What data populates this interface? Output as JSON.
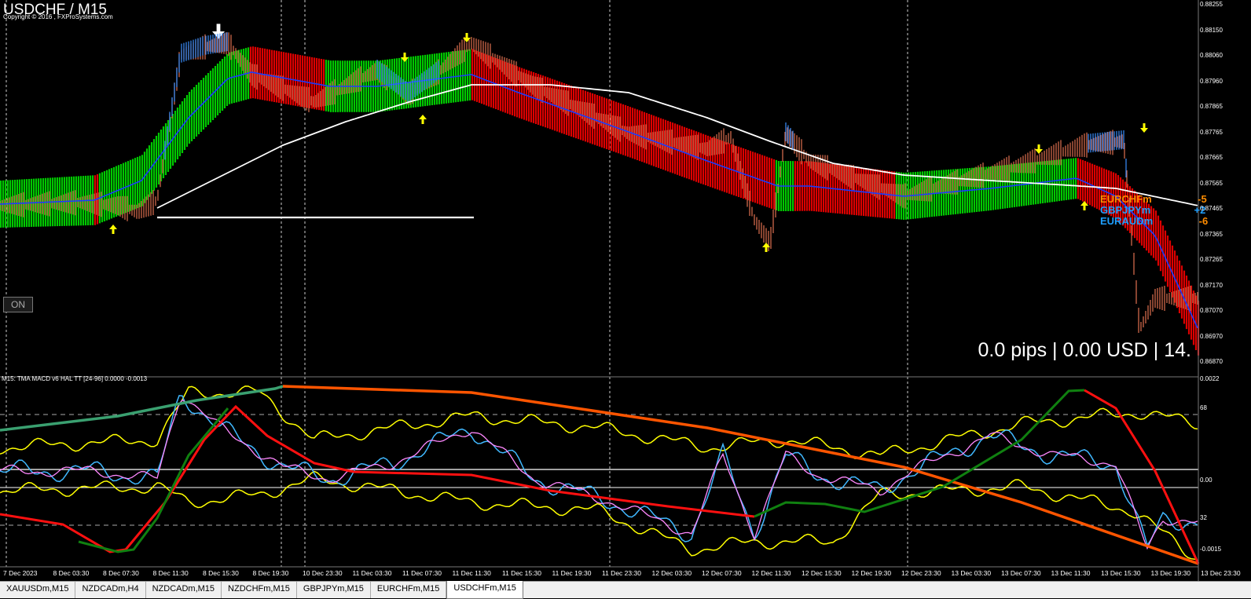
{
  "chart": {
    "title": "USDCHF / M15",
    "copyright": "Copyright © 2016 , FXProSystems.com",
    "on_button": "ON",
    "pips_readout": "0.0 pips | 0.00 USD | 14.",
    "indicator_label": "M15: TMA MACD v6 HAL TT [24-96] 0.0000 -0.0013",
    "symbols": [
      {
        "name": "EURCHFm",
        "value": "-5",
        "color": "#ff8c00"
      },
      {
        "name": "GBPJPYm",
        "value": "+2",
        "color": "#1e9fff"
      },
      {
        "name": "EURAUDm",
        "value": "-6",
        "color": "#1e9fff"
      }
    ],
    "price_axis": [
      "0.88255",
      "0.88150",
      "0.88060",
      "0.87960",
      "0.87865",
      "0.87765",
      "0.87665",
      "0.87565",
      "0.87465",
      "0.87365",
      "0.87265",
      "0.87170",
      "0.87070",
      "0.86970",
      "0.86870"
    ],
    "indicator_axis": [
      "0.0022",
      "68",
      "0.00",
      "32",
      "-0.0015"
    ],
    "time_axis": [
      "7 Dec 2023",
      "8 Dec 03:30",
      "8 Dec 07:30",
      "8 Dec 11:30",
      "8 Dec 15:30",
      "8 Dec 19:30",
      "10 Dec 23:30",
      "11 Dec 03:30",
      "11 Dec 07:30",
      "11 Dec 11:30",
      "11 Dec 15:30",
      "11 Dec 19:30",
      "11 Dec 23:30",
      "12 Dec 03:30",
      "12 Dec 07:30",
      "12 Dec 11:30",
      "12 Dec 15:30",
      "12 Dec 19:30",
      "12 Dec 23:30",
      "13 Dec 03:30",
      "13 Dec 07:30",
      "13 Dec 11:30",
      "13 Dec 15:30",
      "13 Dec 19:30",
      "13 Dec 23:30"
    ],
    "colors": {
      "bull": "#00c800",
      "bear": "#dd0000",
      "mid": "#1a3cff",
      "ma": "#ffffff",
      "arrow": "#ffff00"
    }
  },
  "tabs": [
    {
      "label": "XAUUSDm,M15",
      "active": false
    },
    {
      "label": "NZDCADm,H4",
      "active": false
    },
    {
      "label": "NZDCADm,M15",
      "active": false
    },
    {
      "label": "NZDCHFm,M15",
      "active": false
    },
    {
      "label": "GBPJPYm,M15",
      "active": false
    },
    {
      "label": "EURCHFm,M15",
      "active": false
    },
    {
      "label": "USDCHFm,M15",
      "active": true
    }
  ]
}
